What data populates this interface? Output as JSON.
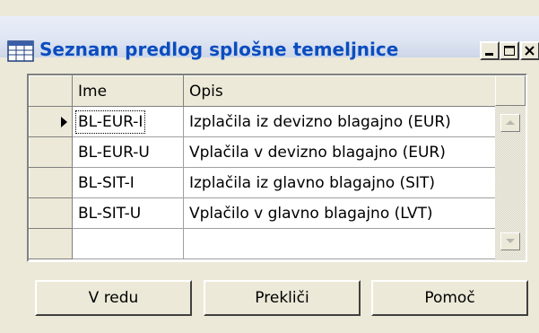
{
  "window": {
    "title": "Seznam predlog splošne temeljnice",
    "icon": "table-icon"
  },
  "grid": {
    "columns": [
      "Ime",
      "Opis"
    ],
    "rows": [
      {
        "ime": "BL-EUR-I",
        "opis": "Izplačila iz devizno blagajno (EUR)",
        "selected": true
      },
      {
        "ime": "BL-EUR-U",
        "opis": "Vplačila v devizno blagajno (EUR)",
        "selected": false
      },
      {
        "ime": "BL-SIT-I",
        "opis": "Izplačila iz glavno blagajno (SIT)",
        "selected": false
      },
      {
        "ime": "BL-SIT-U",
        "opis": "Vplačilo v glavno blagajno (LVT)",
        "selected": false
      },
      {
        "ime": "",
        "opis": "",
        "selected": false
      }
    ]
  },
  "buttons": {
    "ok": "V redu",
    "cancel": "Prekliči",
    "help": "Pomoč"
  }
}
